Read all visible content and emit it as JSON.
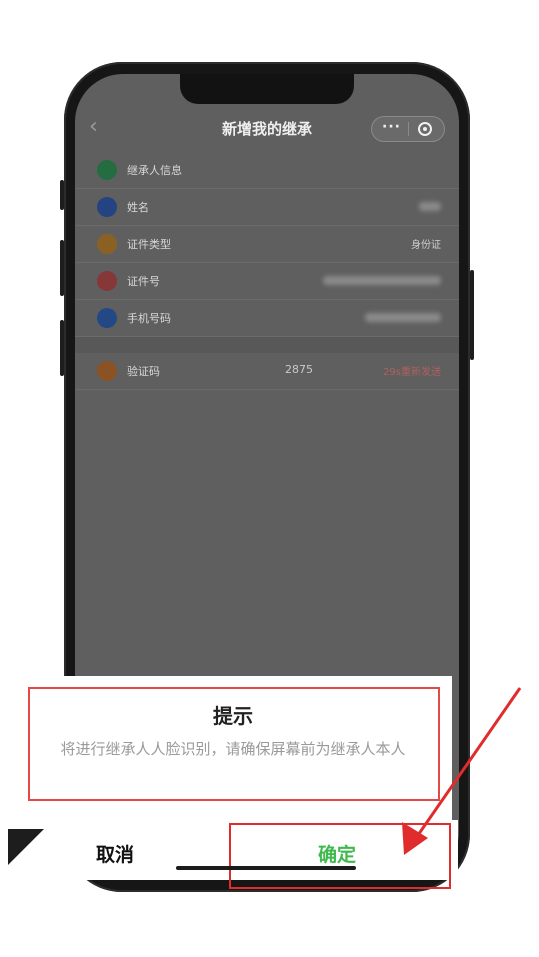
{
  "nav": {
    "back": "‹",
    "title": "新增我的继承",
    "more": "···"
  },
  "form": {
    "section": "继承人信息",
    "rows": [
      {
        "label": "姓名",
        "color": "#3b6fd8"
      },
      {
        "label": "证件类型",
        "value": "身份证",
        "color": "#e8a23a"
      },
      {
        "label": "证件号",
        "color": "#e05b5b"
      },
      {
        "label": "手机号码",
        "color": "#3a78e0"
      }
    ],
    "verify": {
      "label": "验证码",
      "code": "2875",
      "resend": "29s重新发送",
      "color": "#e88a3a"
    }
  },
  "dialog": {
    "title": "提示",
    "message": "将进行继承人人脸识别，请确保屏幕前为继承人本人",
    "cancel": "取消",
    "confirm": "确定"
  },
  "colors": {
    "confirm": "#3fb94e",
    "highlight": "#e02c2c",
    "section_icon": "#3bb56a"
  }
}
